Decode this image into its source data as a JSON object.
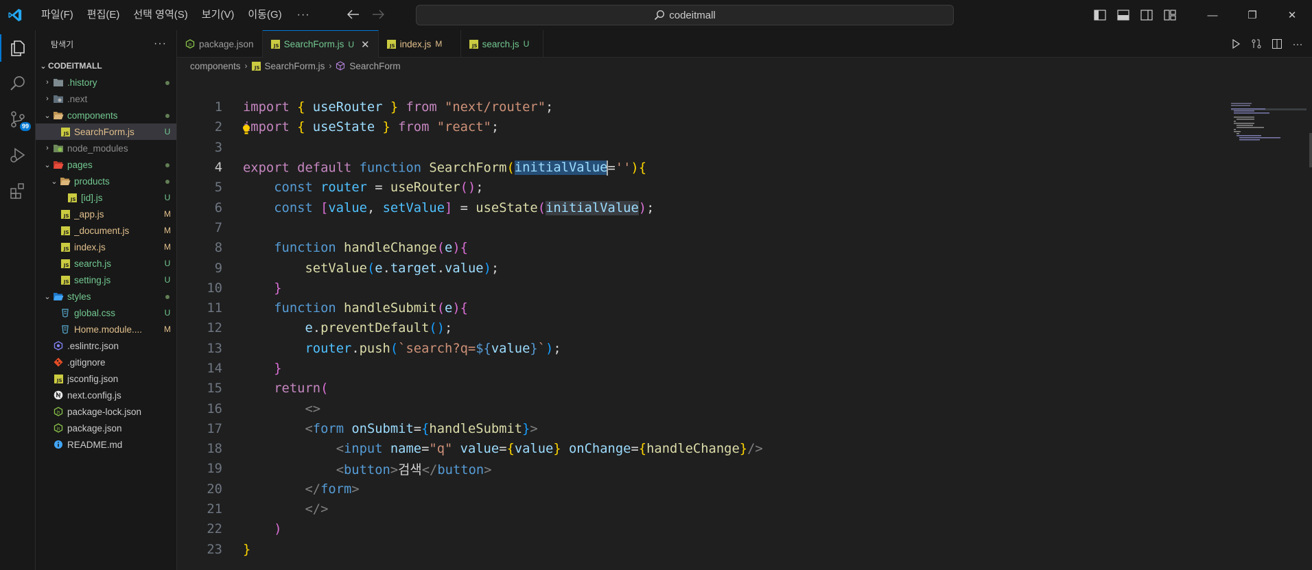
{
  "titlebar": {
    "menus": [
      "파일(F)",
      "편집(E)",
      "선택 영역(S)",
      "보기(V)",
      "이동(G)"
    ],
    "more": "···",
    "search_text": "codeitmall",
    "min_symbol": "—",
    "max_symbol": "❐",
    "close_symbol": "✕"
  },
  "activity": {
    "scm_badge": "99"
  },
  "sidebar": {
    "title": "탐색기",
    "more": "···",
    "root": "CODEITMALL",
    "items": [
      {
        "name": ".history",
        "chev": "›",
        "indent": 0,
        "icon": "folder",
        "color": "#73c991",
        "status": "dot"
      },
      {
        "name": ".next",
        "chev": "›",
        "indent": 0,
        "icon": "folder-grey",
        "color": "#8c8c8c",
        "status": ""
      },
      {
        "name": "components",
        "chev": "⌄",
        "indent": 0,
        "icon": "folder-open",
        "color": "#73c991",
        "status": "dot"
      },
      {
        "name": "SearchForm.js",
        "chev": "",
        "indent": 1,
        "icon": "js",
        "color": "#e2c08d",
        "status": "U",
        "selected": true
      },
      {
        "name": "node_modules",
        "chev": "›",
        "indent": 0,
        "icon": "folder-green",
        "color": "#8c8c8c",
        "status": ""
      },
      {
        "name": "pages",
        "chev": "⌄",
        "indent": 0,
        "icon": "folder-red",
        "color": "#73c991",
        "status": "dot"
      },
      {
        "name": "products",
        "chev": "⌄",
        "indent": 1,
        "icon": "folder-open",
        "color": "#73c991",
        "status": "dot"
      },
      {
        "name": "[id].js",
        "chev": "",
        "indent": 2,
        "icon": "js",
        "color": "#73c991",
        "status": "U"
      },
      {
        "name": "_app.js",
        "chev": "",
        "indent": 1,
        "icon": "js",
        "color": "#e2c08d",
        "status": "M"
      },
      {
        "name": "_document.js",
        "chev": "",
        "indent": 1,
        "icon": "js",
        "color": "#e2c08d",
        "status": "M"
      },
      {
        "name": "index.js",
        "chev": "",
        "indent": 1,
        "icon": "js",
        "color": "#e2c08d",
        "status": "M"
      },
      {
        "name": "search.js",
        "chev": "",
        "indent": 1,
        "icon": "js",
        "color": "#73c991",
        "status": "U"
      },
      {
        "name": "setting.js",
        "chev": "",
        "indent": 1,
        "icon": "js",
        "color": "#73c991",
        "status": "U"
      },
      {
        "name": "styles",
        "chev": "⌄",
        "indent": 0,
        "icon": "folder-blue",
        "color": "#73c991",
        "status": "dot"
      },
      {
        "name": "global.css",
        "chev": "",
        "indent": 1,
        "icon": "css",
        "color": "#73c991",
        "status": "U"
      },
      {
        "name": "Home.module....",
        "chev": "",
        "indent": 1,
        "icon": "css",
        "color": "#e2c08d",
        "status": "M"
      },
      {
        "name": ".eslintrc.json",
        "chev": "",
        "indent": 0,
        "icon": "eslint",
        "color": "#cccccc",
        "status": ""
      },
      {
        "name": ".gitignore",
        "chev": "",
        "indent": 0,
        "icon": "git",
        "color": "#cccccc",
        "status": ""
      },
      {
        "name": "jsconfig.json",
        "chev": "",
        "indent": 0,
        "icon": "js",
        "color": "#cccccc",
        "status": ""
      },
      {
        "name": "next.config.js",
        "chev": "",
        "indent": 0,
        "icon": "next",
        "color": "#cccccc",
        "status": ""
      },
      {
        "name": "package-lock.json",
        "chev": "",
        "indent": 0,
        "icon": "node",
        "color": "#cccccc",
        "status": ""
      },
      {
        "name": "package.json",
        "chev": "",
        "indent": 0,
        "icon": "node",
        "color": "#cccccc",
        "status": ""
      },
      {
        "name": "README.md",
        "chev": "",
        "indent": 0,
        "icon": "info",
        "color": "#cccccc",
        "status": ""
      }
    ]
  },
  "tabs": [
    {
      "label": "package.json",
      "status": "",
      "icon": "node",
      "active": false,
      "color": "#9d9d9d"
    },
    {
      "label": "SearchForm.js",
      "status": "U",
      "icon": "js",
      "active": true,
      "color": "#73c991"
    },
    {
      "label": "index.js",
      "status": "M",
      "icon": "js",
      "active": false,
      "color": "#e2c08d"
    },
    {
      "label": "search.js",
      "status": "U",
      "icon": "js",
      "active": false,
      "color": "#73c991"
    }
  ],
  "breadcrumb": {
    "folder": "components",
    "file": "SearchForm.js",
    "symbol": "SearchForm",
    "sep": "›"
  },
  "code": {
    "line_numbers": [
      "1",
      "2",
      "3",
      "4",
      "5",
      "6",
      "7",
      "8",
      "9",
      "10",
      "11",
      "12",
      "13",
      "14",
      "15",
      "16",
      "17",
      "18",
      "19",
      "20",
      "21",
      "22",
      "23"
    ],
    "current_line": "4",
    "l1": [
      "import",
      " ",
      "{",
      " useRouter ",
      "}",
      " from ",
      "\"next/router\"",
      ";"
    ],
    "l2": [
      "import",
      " ",
      "{",
      " useState ",
      "}",
      " from ",
      "\"react\"",
      ";"
    ],
    "l4": [
      "export",
      " ",
      "default",
      " ",
      "function",
      " ",
      "SearchForm",
      "(",
      "initialValue",
      "=",
      "''",
      ")",
      "{"
    ],
    "l5": [
      "    ",
      "const",
      " ",
      "router",
      " = ",
      "useRouter",
      "(",
      ")",
      ";"
    ],
    "l6": [
      "    ",
      "const",
      " ",
      "[",
      "value",
      ", ",
      "setValue",
      "]",
      " = ",
      "useState",
      "(",
      "initialValue",
      ")",
      ";"
    ],
    "l8": [
      "    ",
      "function",
      " ",
      "handleChange",
      "(",
      "e",
      ")",
      "{"
    ],
    "l9": [
      "        ",
      "setValue",
      "(",
      "e",
      ".",
      "target",
      ".",
      "value",
      ")",
      ";"
    ],
    "l10": [
      "    ",
      "}"
    ],
    "l11": [
      "    ",
      "function",
      " ",
      "handleSubmit",
      "(",
      "e",
      ")",
      "{"
    ],
    "l12": [
      "        ",
      "e",
      ".",
      "preventDefault",
      "(",
      ")",
      ";"
    ],
    "l13": [
      "        ",
      "router",
      ".",
      "push",
      "(",
      "`search?q=",
      "${",
      "value",
      "}",
      "`",
      ")",
      ";"
    ],
    "l14": [
      "    ",
      "}"
    ],
    "l15": [
      "    ",
      "return",
      "("
    ],
    "l16": [
      "        ",
      "<>"
    ],
    "l17": [
      "        ",
      "<",
      "form",
      " ",
      "onSubmit",
      "=",
      "{",
      "handleSubmit",
      "}",
      ">"
    ],
    "l18": [
      "            ",
      "<",
      "input",
      " ",
      "name",
      "=",
      "\"q\"",
      " ",
      "value",
      "=",
      "{",
      "value",
      "}",
      " ",
      "onChange",
      "=",
      "{",
      "handleChange",
      "}",
      "/>"
    ],
    "l19": [
      "            ",
      "<",
      "button",
      ">",
      "검색",
      "</",
      "button",
      ">"
    ],
    "l20": [
      "        ",
      "</",
      "form",
      ">"
    ],
    "l21": [
      "        ",
      "</>"
    ],
    "l22": [
      "    ",
      ")"
    ],
    "l23": [
      "",
      "}"
    ]
  },
  "colors": {
    "accent": "#0078d4",
    "untracked": "#73c991",
    "modified": "#e2c08d"
  }
}
